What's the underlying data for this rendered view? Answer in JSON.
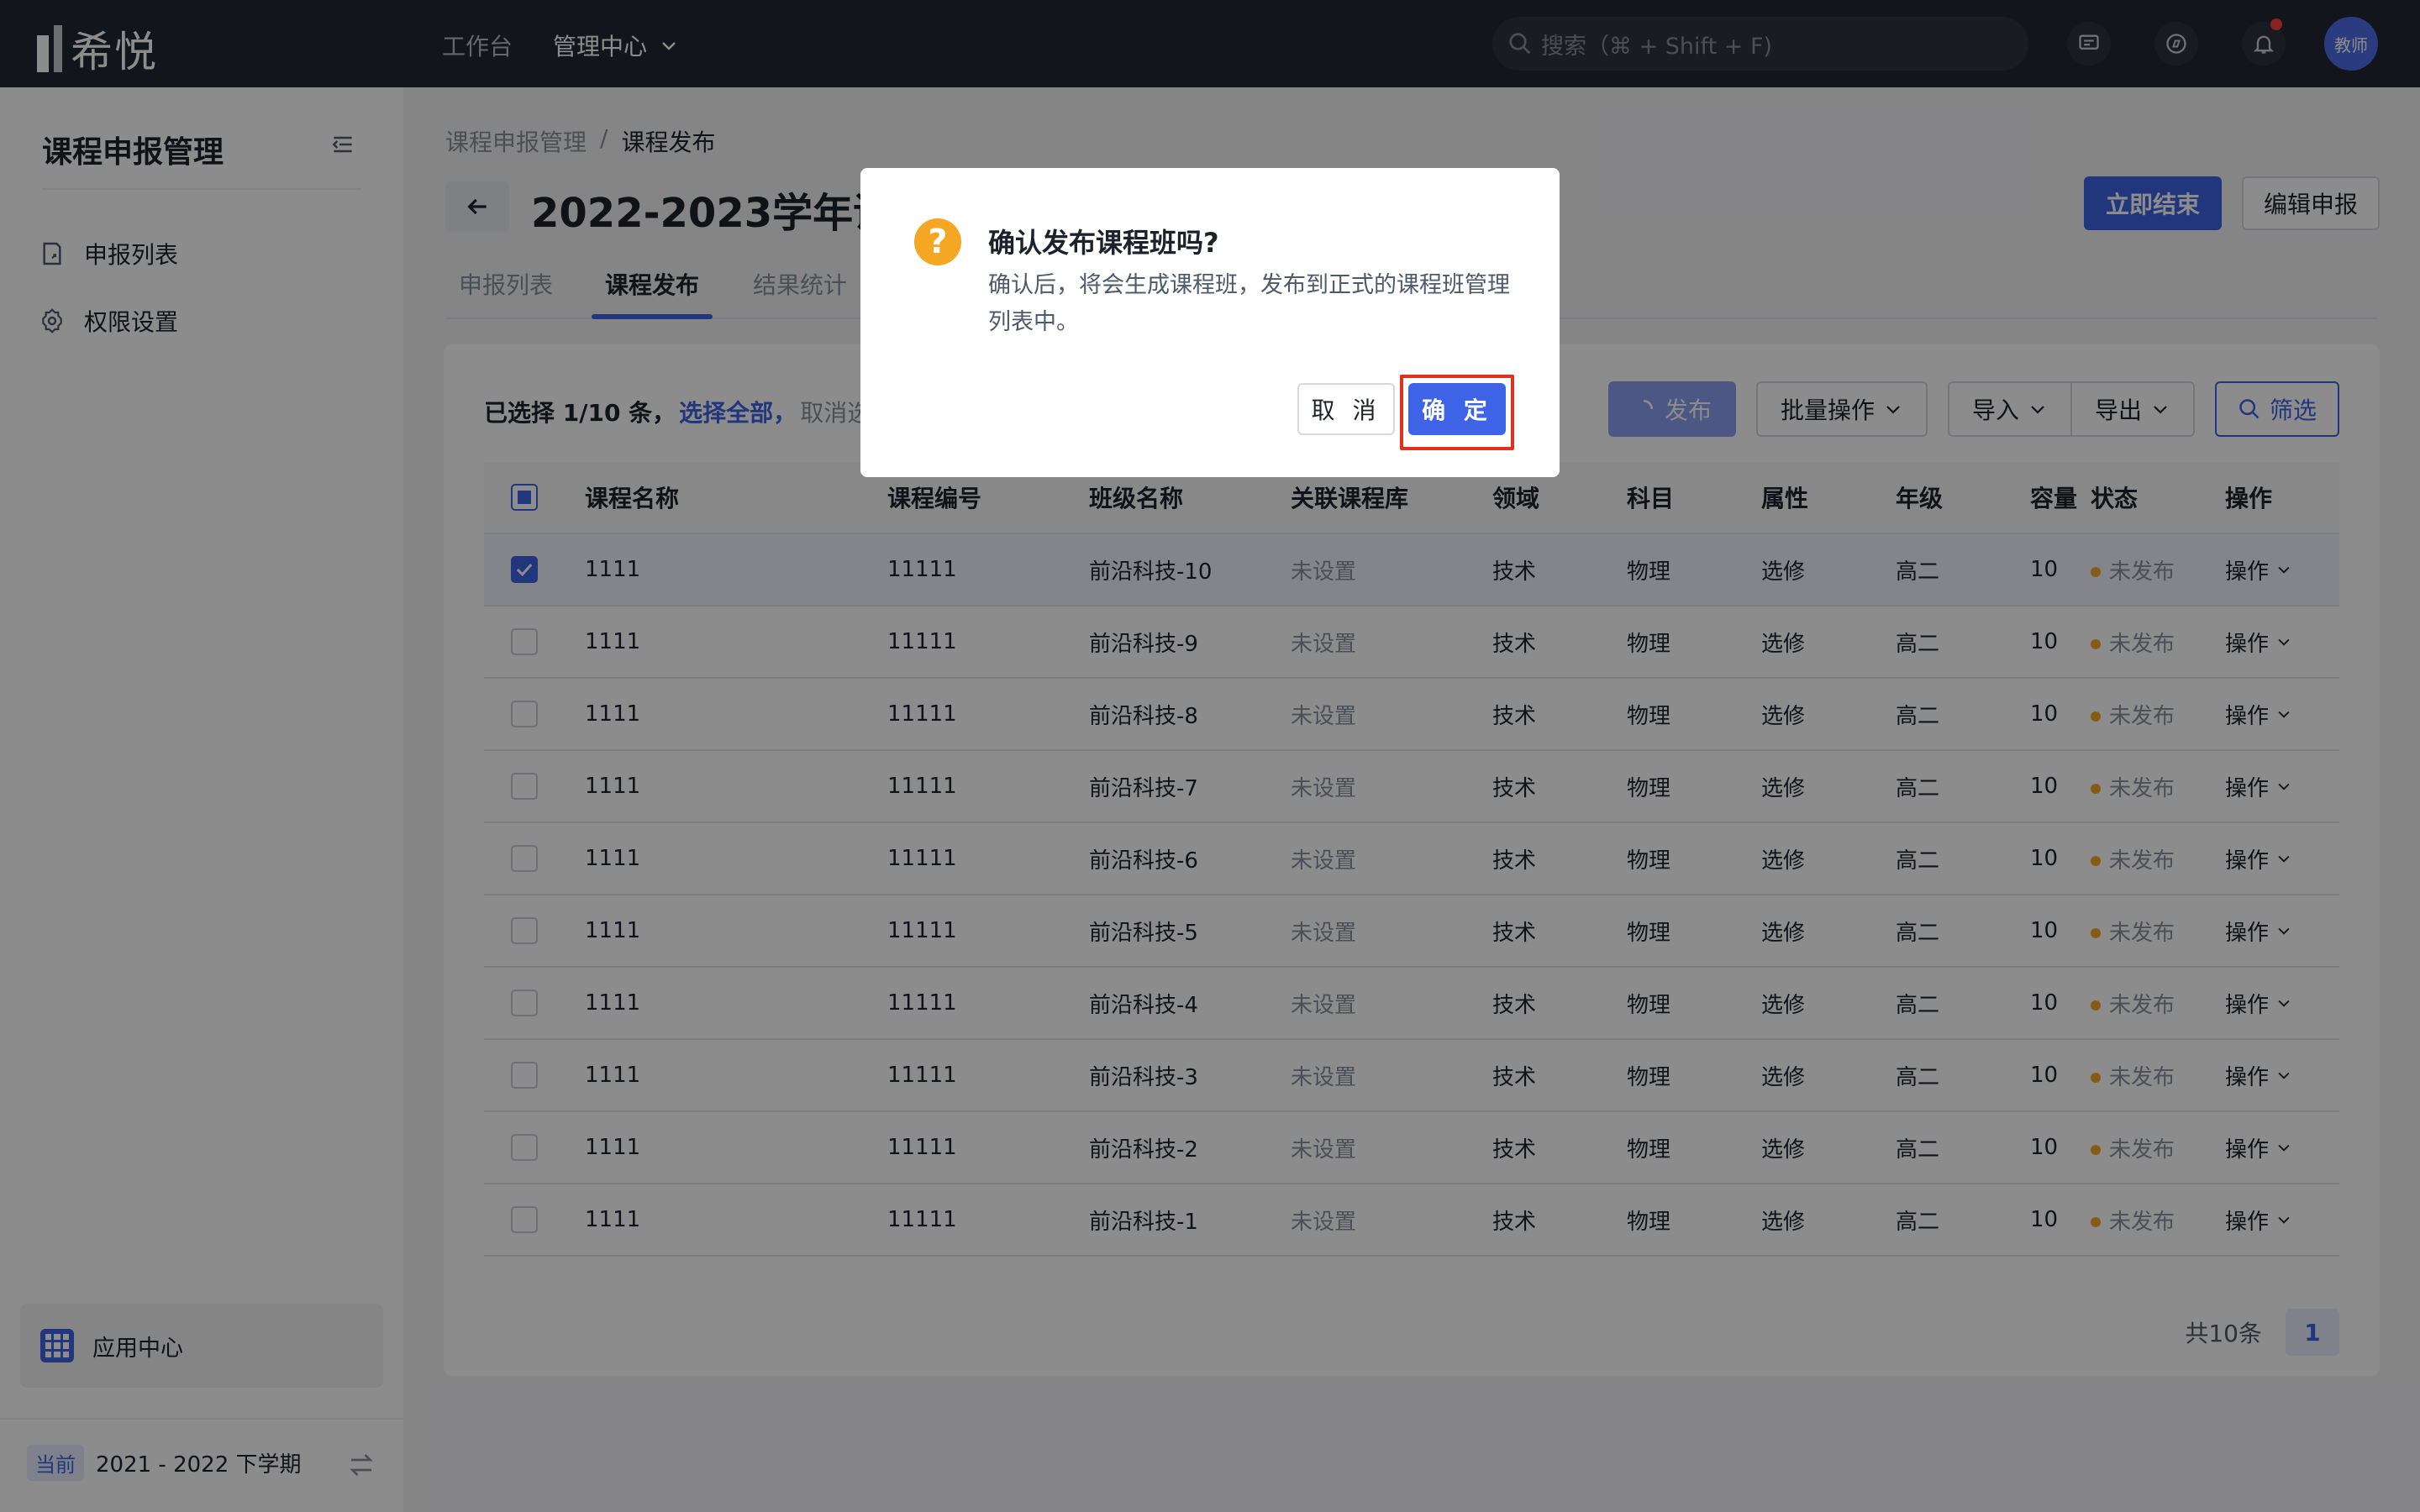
{
  "topbar": {
    "brand": "希悦",
    "nav": [
      "工作台",
      "管理中心"
    ],
    "search_placeholder": "搜索（⌘ + Shift + F)",
    "avatar_label": "教师"
  },
  "sidebar": {
    "title": "课程申报管理",
    "items": [
      {
        "label": "申报列表",
        "icon": "document-icon"
      },
      {
        "label": "权限设置",
        "icon": "gear-icon"
      }
    ],
    "app_center": "应用中心",
    "term_badge": "当前",
    "term": "2021 - 2022 下学期"
  },
  "main": {
    "breadcrumb": [
      "课程申报管理",
      "/",
      "课程发布"
    ],
    "title": "2022-2023学年课程申报",
    "end_now": "立即结束",
    "edit_apply": "编辑申报",
    "tabs": [
      "申报列表",
      "课程发布",
      "结果统计"
    ]
  },
  "toolbar": {
    "selected_text": "已选择 1/10 条，",
    "select_all": "选择全部，",
    "cancel_select": "取消选择",
    "publish": "发布",
    "batch": "批量操作",
    "import": "导入",
    "export": "导出",
    "filter": "筛选"
  },
  "table": {
    "columns": [
      "课程名称",
      "课程编号",
      "班级名称",
      "关联课程库",
      "领域",
      "科目",
      "属性",
      "年级",
      "容量",
      "状态",
      "操作"
    ],
    "rows": [
      [
        "1111",
        "11111",
        "前沿科技-10",
        "未设置",
        "技术",
        "物理",
        "选修",
        "高二",
        "10",
        "未发布",
        "操作"
      ],
      [
        "1111",
        "11111",
        "前沿科技-9",
        "未设置",
        "技术",
        "物理",
        "选修",
        "高二",
        "10",
        "未发布",
        "操作"
      ],
      [
        "1111",
        "11111",
        "前沿科技-8",
        "未设置",
        "技术",
        "物理",
        "选修",
        "高二",
        "10",
        "未发布",
        "操作"
      ],
      [
        "1111",
        "11111",
        "前沿科技-7",
        "未设置",
        "技术",
        "物理",
        "选修",
        "高二",
        "10",
        "未发布",
        "操作"
      ],
      [
        "1111",
        "11111",
        "前沿科技-6",
        "未设置",
        "技术",
        "物理",
        "选修",
        "高二",
        "10",
        "未发布",
        "操作"
      ],
      [
        "1111",
        "11111",
        "前沿科技-5",
        "未设置",
        "技术",
        "物理",
        "选修",
        "高二",
        "10",
        "未发布",
        "操作"
      ],
      [
        "1111",
        "11111",
        "前沿科技-4",
        "未设置",
        "技术",
        "物理",
        "选修",
        "高二",
        "10",
        "未发布",
        "操作"
      ],
      [
        "1111",
        "11111",
        "前沿科技-3",
        "未设置",
        "技术",
        "物理",
        "选修",
        "高二",
        "10",
        "未发布",
        "操作"
      ],
      [
        "1111",
        "11111",
        "前沿科技-2",
        "未设置",
        "技术",
        "物理",
        "选修",
        "高二",
        "10",
        "未发布",
        "操作"
      ],
      [
        "1111",
        "11111",
        "前沿科技-1",
        "未设置",
        "技术",
        "物理",
        "选修",
        "高二",
        "10",
        "未发布",
        "操作"
      ]
    ],
    "selected_row_index": 0
  },
  "pagination": {
    "total": "共10条",
    "current_page": "1"
  },
  "modal": {
    "title": "确认发布课程班吗?",
    "body": "确认后，将会生成课程班，发布到正式的课程班管理列表中。",
    "cancel": "取 消",
    "ok": "确 定"
  },
  "colors": {
    "accent": "#3f63e6",
    "warning": "#f5a623",
    "highlight": "#e0301e",
    "topbar": "#232733"
  }
}
